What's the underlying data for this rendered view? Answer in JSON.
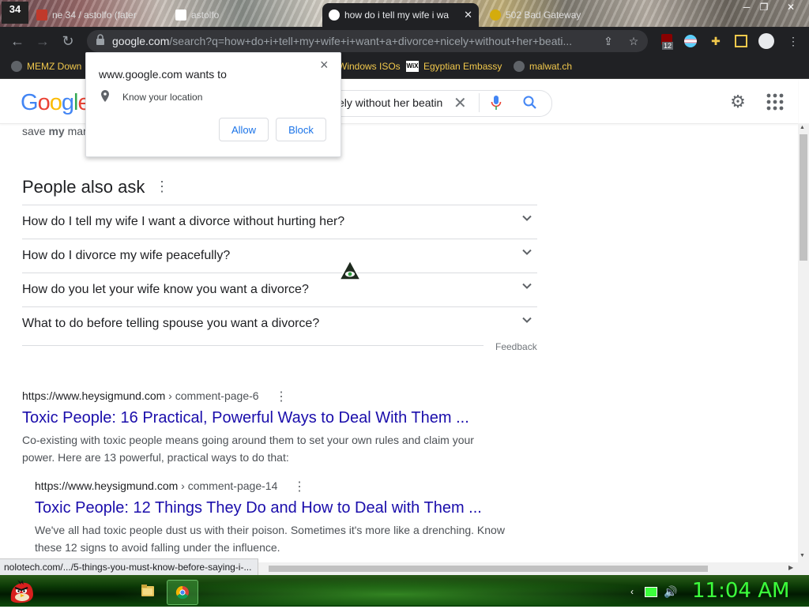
{
  "browser": {
    "badge": "34",
    "tabs": [
      {
        "label": "ne 34 / astolfo (fater",
        "active": false
      },
      {
        "label": "astolfo",
        "active": false
      },
      {
        "label": "how do i tell my wife i wa",
        "active": true
      },
      {
        "label": "502 Bad Gateway",
        "active": false
      }
    ],
    "url_host": "google.com",
    "url_path": "/search?q=how+do+i+tell+my+wife+i+want+a+divorce+nicely+without+her+beati...",
    "extension_badge": "12",
    "bookmarks": [
      "MEMZ Down",
      "Windows ISOs",
      "Egyptian Embassy",
      "malwat.ch"
    ]
  },
  "google": {
    "logo": "Google",
    "query_visible": "ely without her beatin"
  },
  "popup": {
    "title": "www.google.com wants to",
    "permission": "Know your location",
    "allow": "Allow",
    "block": "Block",
    "close": "×"
  },
  "content": {
    "snippet_prefix": "save ",
    "snippet_bold": "my",
    "snippet_rest": " mar",
    "snippet_end": ".",
    "paa_title": "People also ask",
    "paa_questions": [
      "How do I tell my wife I want a divorce without hurting her?",
      "How do I divorce my wife peacefully?",
      "How do you let your wife know you want a divorce?",
      "What to do before telling spouse you want a divorce?"
    ],
    "feedback": "Feedback",
    "results": [
      {
        "site": "https://www.heysigmund.com",
        "crumb": " › comment-page-6",
        "title": "Toxic People: 16 Practical, Powerful Ways to Deal With Them ...",
        "desc": "Co-existing with toxic people means going around them to set your own rules and claim your power. Here are 13 powerful, practical ways to do that:"
      },
      {
        "site": "https://www.heysigmund.com",
        "crumb": " › comment-page-14",
        "title": "Toxic People: 12 Things They Do and How to Deal with Them ...",
        "desc": "We've all had toxic people dust us with their poison. Sometimes it's more like a drenching. Know these 12 signs to avoid falling under the influence."
      }
    ]
  },
  "status_url": "nolotech.com/.../5-things-you-must-know-before-saying-i-...",
  "taskbar": {
    "clock": "11:04 AM"
  },
  "colors": {
    "link": "#1a0dab",
    "bookmark_text": "#f2c94c",
    "clock": "#3cff3c",
    "chrome_dark": "#202124"
  }
}
